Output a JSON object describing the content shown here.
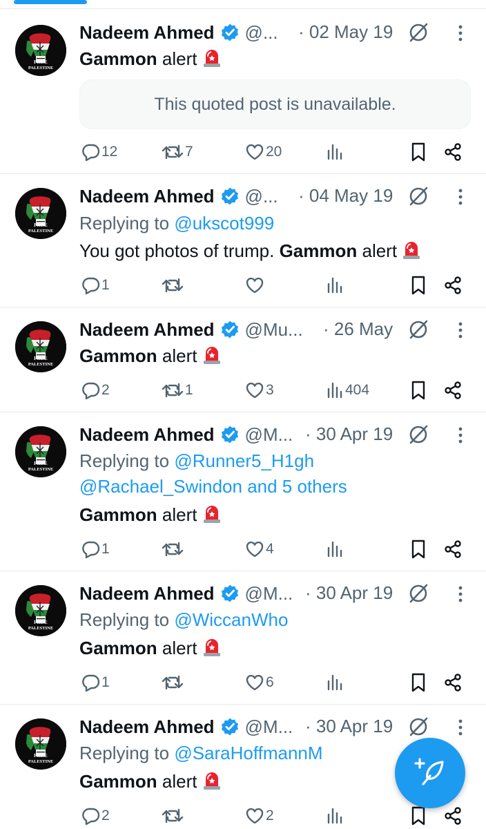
{
  "tabs_indicator_color": "#1d9bf0",
  "colors": {
    "text": "#0f1419",
    "secondary": "#536471",
    "link": "#1d9bf0",
    "verified": "#1d9bf0",
    "fab": "#1d9bf0"
  },
  "tweets": [
    {
      "name": "Nadeem Ahmed",
      "handle": "@...",
      "date": "· 02 May 19",
      "text_bold": "Gammon",
      "text_after": " alert",
      "quote": "This quoted post is unavailable.",
      "replies": "12",
      "reposts": "7",
      "likes": "20",
      "views": ""
    },
    {
      "name": "Nadeem Ahmed",
      "handle": "@...",
      "date": "· 04 May 19",
      "replying_prefix": "Replying to",
      "replying_to": "@ukscot999",
      "text_before": "You got photos of trump. ",
      "text_bold": "Gammon",
      "text_after": " alert",
      "replies": "1",
      "reposts": "",
      "likes": "",
      "views": ""
    },
    {
      "name": "Nadeem Ahmed",
      "handle": "@Mu...",
      "date": "· 26 May",
      "text_bold": "Gammon",
      "text_after": " alert",
      "replies": "2",
      "reposts": "1",
      "likes": "3",
      "views": "404"
    },
    {
      "name": "Nadeem Ahmed",
      "handle": "@M...",
      "date": "· 30 Apr 19",
      "replying_prefix": "Replying to",
      "replying_to": "@Runner5_H1gh",
      "replying_to_2": "@Rachael_Swindon and 5 others",
      "text_bold": "Gammon",
      "text_after": " alert",
      "replies": "1",
      "reposts": "",
      "likes": "4",
      "views": ""
    },
    {
      "name": "Nadeem Ahmed",
      "handle": "@M...",
      "date": "· 30 Apr 19",
      "replying_prefix": "Replying to",
      "replying_to": "@WiccanWho",
      "text_bold": "Gammon",
      "text_after": " alert",
      "replies": "1",
      "reposts": "",
      "likes": "6",
      "views": ""
    },
    {
      "name": "Nadeem Ahmed",
      "handle": "@M...",
      "date": "· 30 Apr 19",
      "replying_prefix": "Replying to",
      "replying_to": "@SaraHoffmannM",
      "text_bold": "Gammon",
      "text_after": " alert",
      "replies": "2",
      "reposts": "",
      "likes": "2",
      "views": ""
    }
  ],
  "icons": {
    "reply": "reply-icon",
    "repost": "repost-icon",
    "like": "heart-icon",
    "views": "views-icon",
    "bookmark": "bookmark-icon",
    "share": "share-icon",
    "grok": "grok-icon",
    "more": "more-vertical-icon",
    "compose": "compose-post-icon",
    "verified": "verified-badge-icon",
    "siren": "siren-emoji"
  },
  "avatar_text": "FREE PALESTINE"
}
